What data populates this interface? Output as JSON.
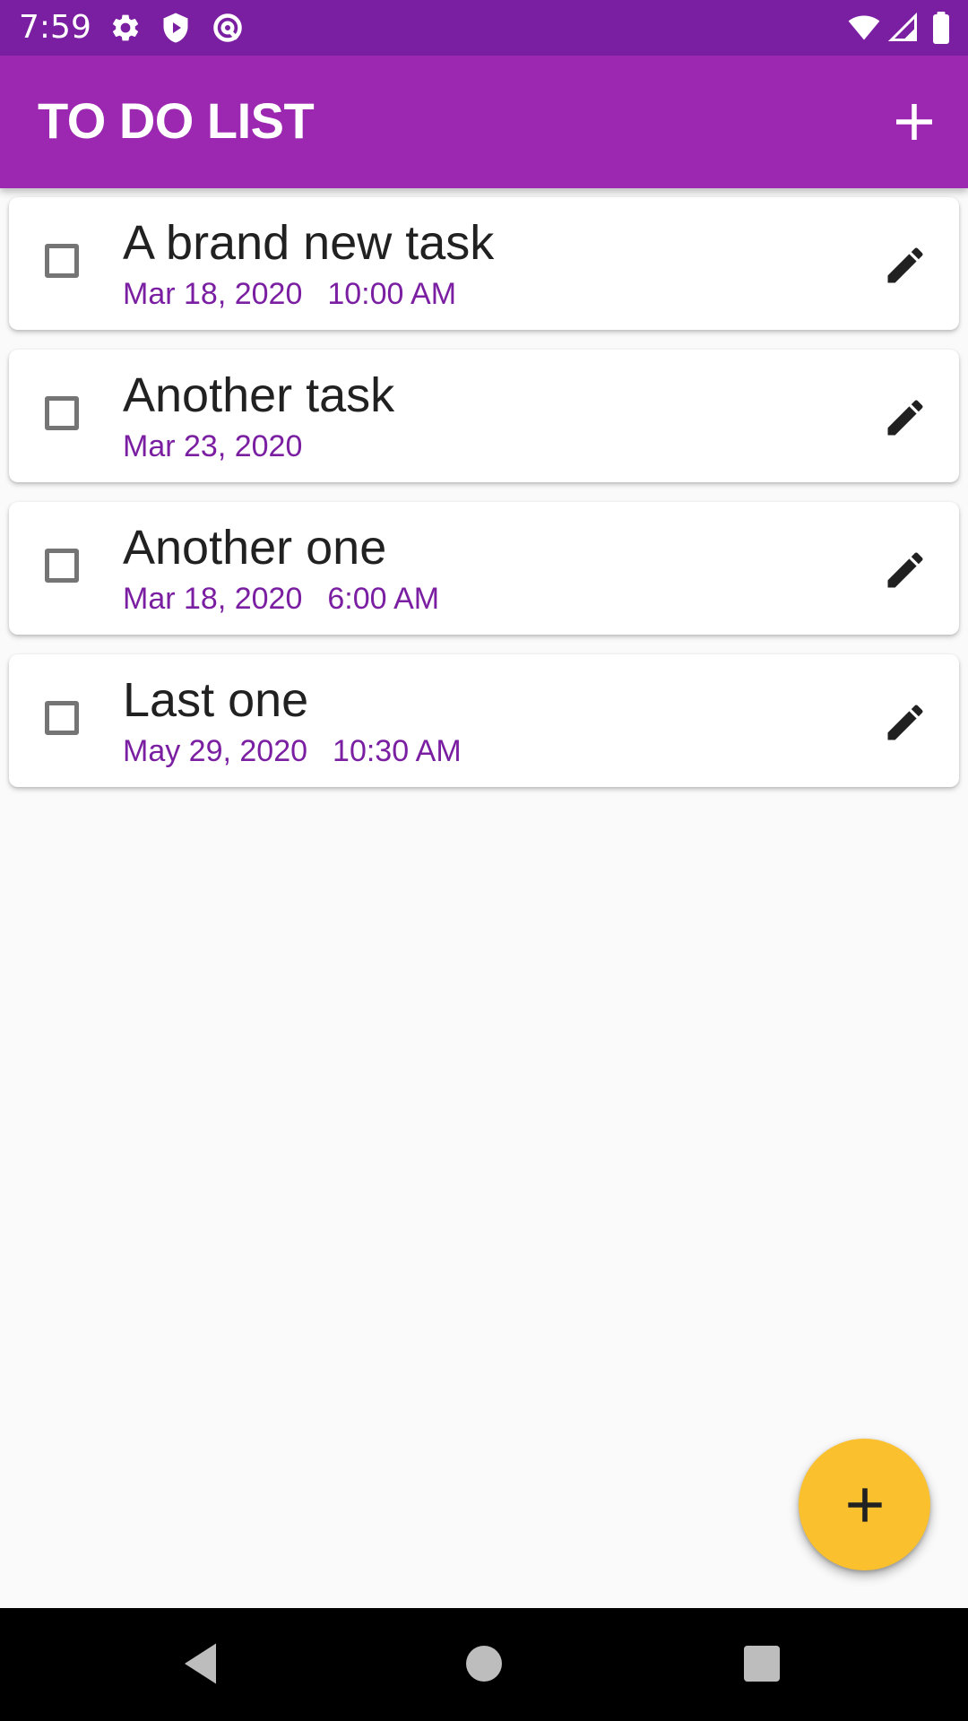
{
  "status_bar": {
    "time": "7:59",
    "icons": [
      "settings-icon",
      "shield-play-icon",
      "at-sign-icon",
      "wifi-icon",
      "signal-icon",
      "battery-icon"
    ]
  },
  "app_bar": {
    "title": "TO DO LIST",
    "add_icon": "plus-icon",
    "background": "#9C27B0"
  },
  "tasks": [
    {
      "title": "A brand new task",
      "date": "Mar 18, 2020",
      "time": "10:00 AM",
      "checked": false
    },
    {
      "title": "Another task",
      "date": "Mar 23, 2020",
      "time": "",
      "checked": false
    },
    {
      "title": "Another one",
      "date": "Mar 18, 2020",
      "time": "6:00 AM",
      "checked": false
    },
    {
      "title": "Last one",
      "date": "May 29, 2020",
      "time": "10:30 AM",
      "checked": false
    }
  ],
  "fab": {
    "icon": "plus-icon",
    "color": "#FBC02D"
  },
  "nav_bar": {
    "buttons": [
      "back-icon",
      "home-icon",
      "recents-icon"
    ]
  },
  "colors": {
    "status_bar": "#7B1FA2",
    "accent_text": "#7B1FA2",
    "background": "#FAFAFA"
  }
}
